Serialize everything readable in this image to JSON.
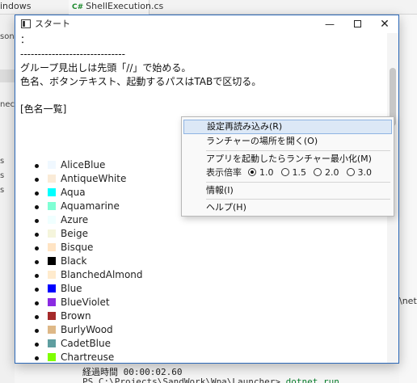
{
  "background": {
    "left_tab": "indows",
    "tab_file": "ShellExecution.cs",
    "tab_lang_badge": "C#",
    "sidebar_fragments": [
      "son",
      "neco",
      "s",
      "s",
      "s"
    ],
    "right_fragment": "\\net",
    "console": {
      "elapsed": "経過時間 00:00:02.60",
      "prompt_path": "PS C:\\Projects\\SandWork\\Wpa\\Launcher>",
      "prompt_cmd": "dotnet run"
    }
  },
  "window": {
    "title": "スタート",
    "minimize_glyph": "—",
    "close_glyph": "✕"
  },
  "content": {
    "line1": "：",
    "dashes": "------------------------------",
    "line3": "グループ見出しは先頭「//」で始める。",
    "line4": "色名、ボタンテキスト、起動するパスはTABで区切る。",
    "section_header": "[色名一覧]"
  },
  "colors": [
    {
      "name": "AliceBlue",
      "hex": "#F0F8FF"
    },
    {
      "name": "AntiqueWhite",
      "hex": "#FAEBD7"
    },
    {
      "name": "Aqua",
      "hex": "#00FFFF"
    },
    {
      "name": "Aquamarine",
      "hex": "#7FFFD4"
    },
    {
      "name": "Azure",
      "hex": "#F0FFFF"
    },
    {
      "name": "Beige",
      "hex": "#F5F5DC"
    },
    {
      "name": "Bisque",
      "hex": "#FFE4C4"
    },
    {
      "name": "Black",
      "hex": "#000000"
    },
    {
      "name": "BlanchedAlmond",
      "hex": "#FFEBCD"
    },
    {
      "name": "Blue",
      "hex": "#0000FF"
    },
    {
      "name": "BlueViolet",
      "hex": "#8A2BE2"
    },
    {
      "name": "Brown",
      "hex": "#A52A2A"
    },
    {
      "name": "BurlyWood",
      "hex": "#DEB887"
    },
    {
      "name": "CadetBlue",
      "hex": "#5F9EA0"
    },
    {
      "name": "Chartreuse",
      "hex": "#7FFF00"
    }
  ],
  "context_menu": {
    "reload": "設定再読み込み(R)",
    "open_location": "ランチャーの場所を開く(O)",
    "minimize_on_launch": "アプリを起動したらランチャー最小化(M)",
    "zoom_label": "表示倍率",
    "zoom_options": [
      "1.0",
      "1.5",
      "2.0",
      "3.0"
    ],
    "zoom_selected": "1.0",
    "info": "情報(I)",
    "help": "ヘルプ(H)"
  },
  "accent_colors": {
    "window_border": "#2b68b8",
    "menu_highlight": "#dce8f6",
    "menu_highlight_border": "#8fb4e3"
  }
}
